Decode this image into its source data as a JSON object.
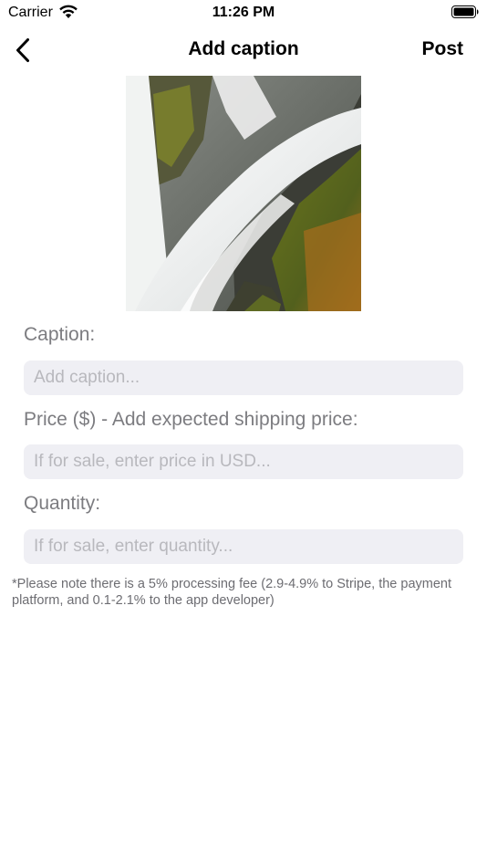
{
  "status_bar": {
    "carrier": "Carrier",
    "time": "11:26 PM",
    "icons": [
      "wifi-icon",
      "battery-icon"
    ]
  },
  "nav": {
    "back_icon": "chevron-left-icon",
    "title": "Add caption",
    "post_label": "Post"
  },
  "photo": {
    "subject": "waterfall"
  },
  "form": {
    "caption_label": "Caption:",
    "caption_placeholder": "Add caption...",
    "caption_value": "",
    "price_label": "Price ($) - Add expected shipping price:",
    "price_placeholder": "If for sale, enter price in USD...",
    "price_value": "",
    "quantity_label": "Quantity:",
    "quantity_placeholder": "If for sale, enter quantity...",
    "quantity_value": ""
  },
  "note": "*Please note there is a 5% processing fee (2.9-4.9% to Stripe, the payment platform, and 0.1-2.1% to the app developer)",
  "colors": {
    "label": "#7c7c80",
    "field_bg": "#efeff4",
    "placeholder": "#b8b8bd"
  }
}
